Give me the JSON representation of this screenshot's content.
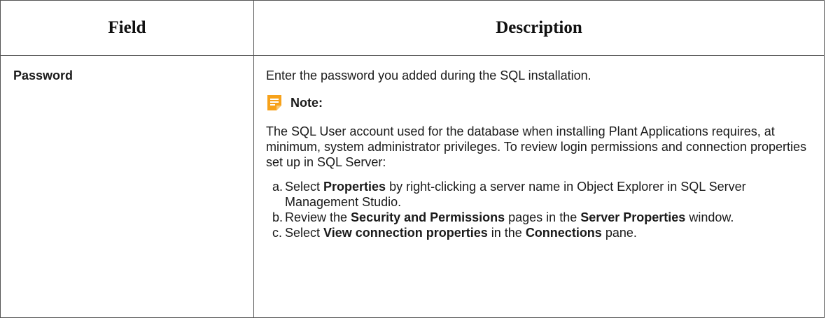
{
  "table": {
    "headers": {
      "field": "Field",
      "description": "Description"
    },
    "row": {
      "field": "Password",
      "description": "Enter the password you added during the SQL installation.",
      "note": {
        "icon": "note-icon",
        "title": "Note:",
        "body": "The SQL User account used for the database when installing Plant Applications requires, at minimum, system administrator privileges. To review login permissions and connection properties set up in SQL Server:",
        "steps": [
          {
            "marker": "a.",
            "parts": [
              {
                "text": "Select ",
                "bold": false
              },
              {
                "text": "Properties",
                "bold": true
              },
              {
                "text": " by right-clicking a server name in Object Explorer in SQL Server Management Studio.",
                "bold": false
              }
            ]
          },
          {
            "marker": "b.",
            "parts": [
              {
                "text": "Review the ",
                "bold": false
              },
              {
                "text": "Security and Permissions",
                "bold": true
              },
              {
                "text": " pages in the ",
                "bold": false
              },
              {
                "text": "Server Properties",
                "bold": true
              },
              {
                "text": " window.",
                "bold": false
              }
            ]
          },
          {
            "marker": "c.",
            "parts": [
              {
                "text": "Select ",
                "bold": false
              },
              {
                "text": "View connection properties",
                "bold": true
              },
              {
                "text": " in the ",
                "bold": false
              },
              {
                "text": "Connections",
                "bold": true
              },
              {
                "text": " pane.",
                "bold": false
              }
            ]
          }
        ]
      }
    }
  },
  "colors": {
    "border": "#555555",
    "note_icon_fill": "#f7a21b",
    "note_icon_lines": "#ffffff"
  }
}
